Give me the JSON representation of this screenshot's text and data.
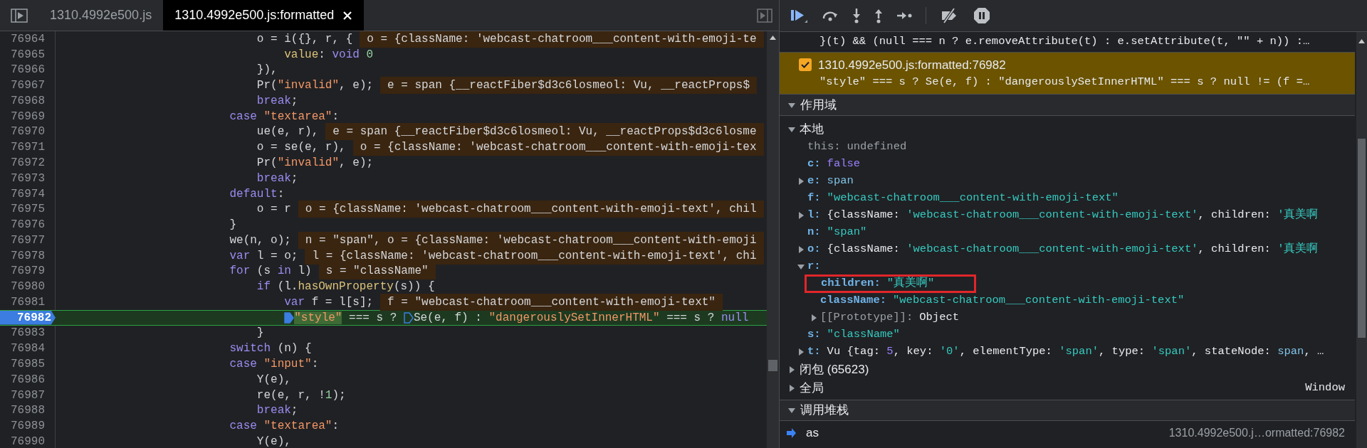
{
  "editor": {
    "tabs": [
      {
        "label": "1310.4992e500.js",
        "selected": false,
        "closable": false
      },
      {
        "label": "1310.4992e500.js:formatted",
        "selected": true,
        "closable": true
      }
    ],
    "lines": [
      {
        "number": "76964",
        "current": false,
        "code": [
          {
            "kind": "plain",
            "text": "                            o = i({}, r, {"
          }
        ],
        "inline_value": "o = {className: 'webcast-chatroom___content-with-emoji-te"
      },
      {
        "number": "76965",
        "current": false,
        "code": [
          {
            "kind": "prop",
            "text": "                                value"
          },
          {
            "kind": "plain",
            "text": ": "
          },
          {
            "kind": "kw",
            "text": "void "
          },
          {
            "kind": "num",
            "text": "0"
          }
        ]
      },
      {
        "number": "76966",
        "current": false,
        "code": [
          {
            "kind": "plain",
            "text": "                            }),"
          }
        ]
      },
      {
        "number": "76967",
        "current": false,
        "code": [
          {
            "kind": "plain",
            "text": "                            Pr("
          },
          {
            "kind": "str",
            "text": "\"invalid\""
          },
          {
            "kind": "plain",
            "text": ", e);"
          }
        ],
        "inline_value": "e = span {__reactFiber$d3c6losmeol: Vu, __reactProps$"
      },
      {
        "number": "76968",
        "current": false,
        "code": [
          {
            "kind": "kw",
            "text": "                            break"
          },
          {
            "kind": "plain",
            "text": ";"
          }
        ]
      },
      {
        "number": "76969",
        "current": false,
        "code": [
          {
            "kind": "kw",
            "text": "                        case "
          },
          {
            "kind": "str",
            "text": "\"textarea\""
          },
          {
            "kind": "plain",
            "text": ":"
          }
        ]
      },
      {
        "number": "76970",
        "current": false,
        "code": [
          {
            "kind": "plain",
            "text": "                            ue(e, r),"
          }
        ],
        "inline_value": "e = span {__reactFiber$d3c6losmeol: Vu, __reactProps$d3c6losme"
      },
      {
        "number": "76971",
        "current": false,
        "code": [
          {
            "kind": "plain",
            "text": "                            o = se(e, r),"
          }
        ],
        "inline_value": "o = {className: 'webcast-chatroom___content-with-emoji-tex"
      },
      {
        "number": "76972",
        "current": false,
        "code": [
          {
            "kind": "plain",
            "text": "                            Pr("
          },
          {
            "kind": "str",
            "text": "\"invalid\""
          },
          {
            "kind": "plain",
            "text": ", e);"
          }
        ]
      },
      {
        "number": "76973",
        "current": false,
        "code": [
          {
            "kind": "kw",
            "text": "                            break"
          },
          {
            "kind": "plain",
            "text": ";"
          }
        ]
      },
      {
        "number": "76974",
        "current": false,
        "code": [
          {
            "kind": "kw",
            "text": "                        default"
          },
          {
            "kind": "plain",
            "text": ":"
          }
        ]
      },
      {
        "number": "76975",
        "current": false,
        "code": [
          {
            "kind": "plain",
            "text": "                            o = r"
          }
        ],
        "inline_value": "o = {className: 'webcast-chatroom___content-with-emoji-text', chil"
      },
      {
        "number": "76976",
        "current": false,
        "code": [
          {
            "kind": "plain",
            "text": "                        }"
          }
        ]
      },
      {
        "number": "76977",
        "current": false,
        "code": [
          {
            "kind": "plain",
            "text": "                        we(n, o);"
          }
        ],
        "inline_value": "n = \"span\", o = {className: 'webcast-chatroom___content-with-emoji"
      },
      {
        "number": "76978",
        "current": false,
        "code": [
          {
            "kind": "kw",
            "text": "                        var"
          },
          {
            "kind": "plain",
            "text": " l = o;"
          }
        ],
        "inline_value": "l = {className: 'webcast-chatroom___content-with-emoji-text', chi"
      },
      {
        "number": "76979",
        "current": false,
        "code": [
          {
            "kind": "kw",
            "text": "                        for"
          },
          {
            "kind": "plain",
            "text": " (s "
          },
          {
            "kind": "kw",
            "text": "in"
          },
          {
            "kind": "plain",
            "text": " l)"
          }
        ],
        "inline_value": "s = \"className\""
      },
      {
        "number": "76980",
        "current": false,
        "code": [
          {
            "kind": "kw",
            "text": "                            if"
          },
          {
            "kind": "plain",
            "text": " (l."
          },
          {
            "kind": "prop",
            "text": "hasOwnProperty"
          },
          {
            "kind": "plain",
            "text": "(s)) {"
          }
        ]
      },
      {
        "number": "76981",
        "current": false,
        "code": [
          {
            "kind": "kw",
            "text": "                                var"
          },
          {
            "kind": "plain",
            "text": " f = l[s];"
          }
        ],
        "inline_value": "f = \"webcast-chatroom___content-with-emoji-text\""
      },
      {
        "number": "76982",
        "current": true,
        "code": [
          {
            "kind": "hl",
            "text": "                                \"style\"",
            "marker_active": true
          },
          {
            "kind": "plain",
            "text": " === s ? "
          },
          {
            "kind": "plain",
            "text": "Se(e, f) : ",
            "marker_active": false
          },
          {
            "kind": "str",
            "text": "\"dangerouslySetInnerHTML\""
          },
          {
            "kind": "plain",
            "text": " === s ? "
          },
          {
            "kind": "kw",
            "text": "null"
          }
        ]
      },
      {
        "number": "76983",
        "current": false,
        "code": [
          {
            "kind": "plain",
            "text": "                            }"
          }
        ]
      },
      {
        "number": "76984",
        "current": false,
        "code": [
          {
            "kind": "kw",
            "text": "                        switch"
          },
          {
            "kind": "plain",
            "text": " (n) {"
          }
        ]
      },
      {
        "number": "76985",
        "current": false,
        "code": [
          {
            "kind": "kw",
            "text": "                        case "
          },
          {
            "kind": "str",
            "text": "\"input\""
          },
          {
            "kind": "plain",
            "text": ":"
          }
        ]
      },
      {
        "number": "76986",
        "current": false,
        "code": [
          {
            "kind": "plain",
            "text": "                            Y(e),"
          }
        ]
      },
      {
        "number": "76987",
        "current": false,
        "code": [
          {
            "kind": "plain",
            "text": "                            re(e, r, !"
          },
          {
            "kind": "num",
            "text": "1"
          },
          {
            "kind": "plain",
            "text": ");"
          }
        ]
      },
      {
        "number": "76988",
        "current": false,
        "code": [
          {
            "kind": "kw",
            "text": "                            break"
          },
          {
            "kind": "plain",
            "text": ";"
          }
        ]
      },
      {
        "number": "76989",
        "current": false,
        "code": [
          {
            "kind": "kw",
            "text": "                        case "
          },
          {
            "kind": "str",
            "text": "\"textarea\""
          },
          {
            "kind": "plain",
            "text": ":"
          }
        ]
      },
      {
        "number": "76990",
        "current": false,
        "code": [
          {
            "kind": "plain",
            "text": "                            Y(e),"
          }
        ]
      }
    ]
  },
  "breakpoints": {
    "partial_code": "}(t) && (null === n ? e.removeAttribute(t) : e.setAttribute(t, \"\" + n)) :…",
    "items": [
      {
        "location": "1310.4992e500.js:formatted:76982",
        "code": "\"style\" === s ? Se(e, f) : \"dangerouslySetInnerHTML\" === s ? null != (f =…",
        "checked": true,
        "paused": true
      }
    ]
  },
  "scope": {
    "title": "作用域",
    "expanded": true,
    "groups": [
      {
        "title": "本地",
        "expanded": true,
        "variables": [
          {
            "name": "this:",
            "kind": "internal",
            "value": [
              {
                "kind": "undef",
                "text": "undefined"
              }
            ]
          },
          {
            "name": "c:",
            "value": [
              {
                "kind": "kw",
                "text": "false"
              }
            ]
          },
          {
            "name": "e:",
            "expanded": false,
            "value": [
              {
                "kind": "node",
                "text": "span"
              }
            ]
          },
          {
            "name": "f:",
            "value": [
              {
                "kind": "str",
                "text": "\"webcast-chatroom___content-with-emoji-text\""
              }
            ]
          },
          {
            "name": "l:",
            "expanded": false,
            "value": [
              {
                "kind": "plain",
                "text": "{className: "
              },
              {
                "kind": "str",
                "text": "'webcast-chatroom___content-with-emoji-text'"
              },
              {
                "kind": "plain",
                "text": ", children: "
              },
              {
                "kind": "str",
                "text": "'真美啊"
              }
            ]
          },
          {
            "name": "n:",
            "value": [
              {
                "kind": "str",
                "text": "\"span\""
              }
            ]
          },
          {
            "name": "o:",
            "expanded": false,
            "value": [
              {
                "kind": "plain",
                "text": "{className: "
              },
              {
                "kind": "str",
                "text": "'webcast-chatroom___content-with-emoji-text'"
              },
              {
                "kind": "plain",
                "text": ", children: "
              },
              {
                "kind": "str",
                "text": "'真美啊"
              }
            ]
          },
          {
            "name": "r:",
            "expanded": true,
            "children": [
              {
                "name": "children:",
                "highlighted": true,
                "value": [
                  {
                    "kind": "str",
                    "text": "\"真美啊\""
                  }
                ]
              },
              {
                "name": "className:",
                "value": [
                  {
                    "kind": "str",
                    "text": "\"webcast-chatroom___content-with-emoji-text\""
                  }
                ]
              },
              {
                "name": "[[Prototype]]:",
                "kind": "internal",
                "expanded": false,
                "value": [
                  {
                    "kind": "plain",
                    "text": "Object"
                  }
                ]
              }
            ]
          },
          {
            "name": "s:",
            "value": [
              {
                "kind": "str",
                "text": "\"className\""
              }
            ]
          },
          {
            "name": "t:",
            "expanded": false,
            "value": [
              {
                "kind": "plain",
                "text": "Vu {tag: "
              },
              {
                "kind": "num",
                "text": "5"
              },
              {
                "kind": "plain",
                "text": ", key: "
              },
              {
                "kind": "str",
                "text": "'0'"
              },
              {
                "kind": "plain",
                "text": ", elementType: "
              },
              {
                "kind": "str",
                "text": "'span'"
              },
              {
                "kind": "plain",
                "text": ", type: "
              },
              {
                "kind": "str",
                "text": "'span'"
              },
              {
                "kind": "plain",
                "text": ", stateNode: "
              },
              {
                "kind": "node",
                "text": "span"
              },
              {
                "kind": "plain",
                "text": ", …"
              }
            ]
          }
        ]
      },
      {
        "title": "闭包 (65623)",
        "expanded": false
      },
      {
        "title": "全局",
        "expanded": false,
        "value": "Window"
      }
    ]
  },
  "call_stack": {
    "title": "调用堆栈",
    "expanded": true,
    "frames": [
      {
        "name": "as",
        "location": "1310.4992e500.j…ormatted:76982",
        "selected": true
      }
    ]
  }
}
